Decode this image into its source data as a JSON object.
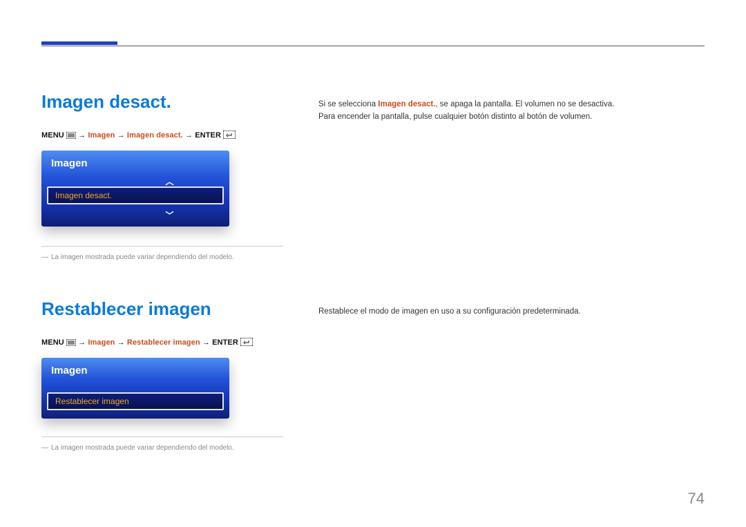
{
  "page_number": "74",
  "section1": {
    "title": "Imagen desact.",
    "breadcrumb": {
      "b_menu": "MENU",
      "b_arrow": " → ",
      "b_imagen": "Imagen",
      "b_target": "Imagen desact.",
      "b_enter": "ENTER"
    },
    "osd": {
      "header": "Imagen",
      "selected": "Imagen desact."
    },
    "footnote_dash": "―",
    "footnote": "La imagen mostrada puede variar dependiendo del modelo.",
    "desc": {
      "line1_prefix": "Si se selecciona ",
      "line1_hl": "Imagen desact.",
      "line1_suffix": ", se apaga la pantalla. El volumen no se desactiva.",
      "line2": "Para encender la pantalla, pulse cualquier botón distinto al botón de volumen."
    }
  },
  "section2": {
    "title": "Restablecer imagen",
    "breadcrumb": {
      "b_menu": "MENU",
      "b_arrow": " → ",
      "b_imagen": "Imagen",
      "b_target": "Restablecer imagen",
      "b_enter": "ENTER"
    },
    "osd": {
      "header": "Imagen",
      "selected": "Restablecer imagen"
    },
    "footnote_dash": "―",
    "footnote": "La imagen mostrada puede variar dependiendo del modelo.",
    "desc": "Restablece el modo de imagen en uso a su configuración predeterminada."
  }
}
